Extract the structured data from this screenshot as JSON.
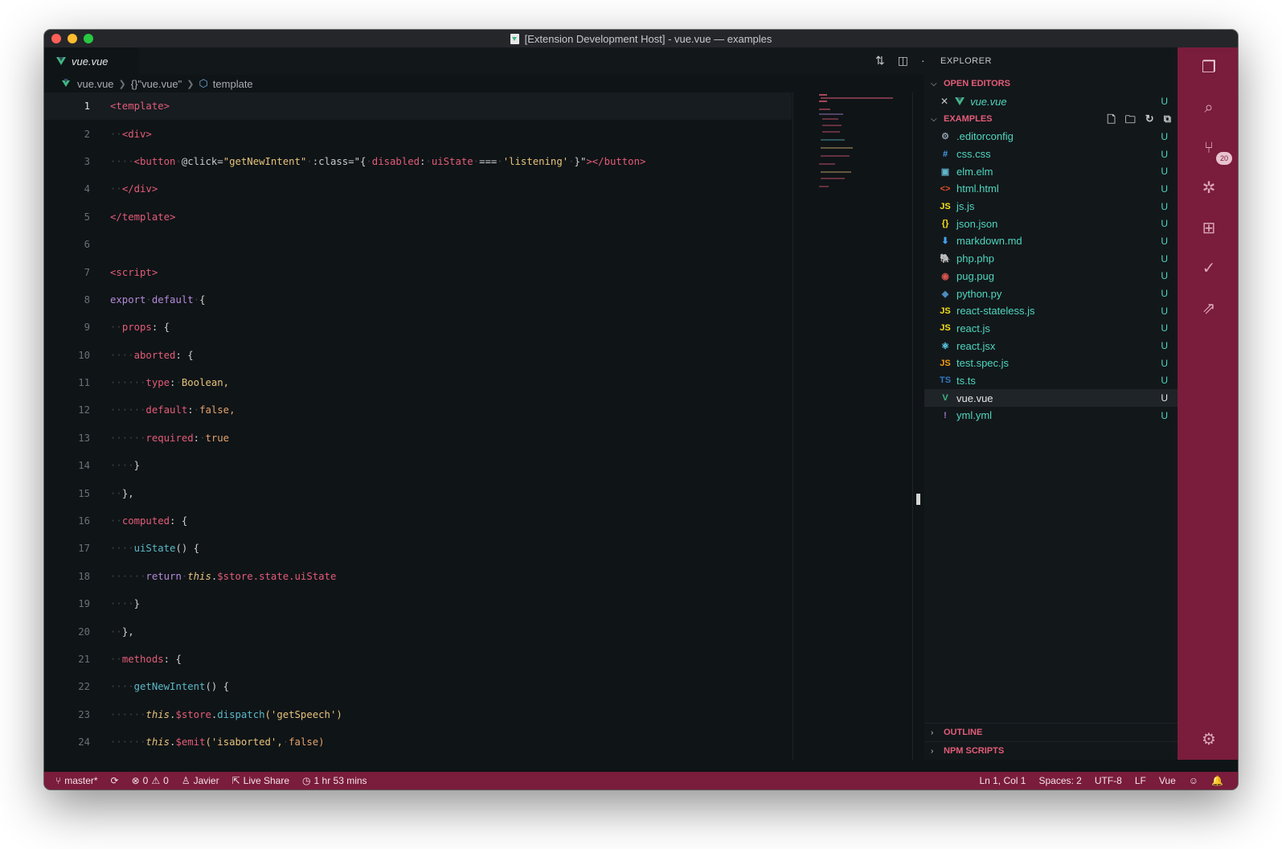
{
  "window": {
    "title": "[Extension Development Host] - vue.vue — examples"
  },
  "tab": {
    "label": "vue.vue"
  },
  "breadcrumb": {
    "file": "vue.vue",
    "object": "{}\"vue.vue\"",
    "node": "template"
  },
  "code_lines": [
    {
      "n": "1"
    },
    {
      "n": "2"
    },
    {
      "n": "3"
    },
    {
      "n": "4"
    },
    {
      "n": "5"
    },
    {
      "n": "6"
    },
    {
      "n": "7"
    },
    {
      "n": "8"
    },
    {
      "n": "9"
    },
    {
      "n": "10"
    },
    {
      "n": "11"
    },
    {
      "n": "12"
    },
    {
      "n": "13"
    },
    {
      "n": "14"
    },
    {
      "n": "15"
    },
    {
      "n": "16"
    },
    {
      "n": "17"
    },
    {
      "n": "18"
    },
    {
      "n": "19"
    },
    {
      "n": "20"
    },
    {
      "n": "21"
    },
    {
      "n": "22"
    },
    {
      "n": "23"
    },
    {
      "n": "24"
    }
  ],
  "code": {
    "l1": "<template>",
    "l2": "<div>",
    "l3_tag": "<button",
    "l3_click": "@click=",
    "l3_click_val": "\"getNewIntent\"",
    "l3_class": ":class=",
    "l3_class_open": "\"{",
    "l3_disabled": "disabled",
    "l3_colon": ":",
    "l3_uistate": "uiState",
    "l3_eq": "===",
    "l3_listening": "'listening'",
    "l3_close": "}\"",
    "l3_endtag": "></button>",
    "l4": "</div>",
    "l5": "</template>",
    "l7": "<script>",
    "l8_export": "export",
    "l8_default": "default",
    "l8_brace": "{",
    "l9_props": "props",
    "l9_rest": ": {",
    "l10_aborted": "aborted",
    "l10_rest": ": {",
    "l11_type": "type",
    "l11_val": "Boolean,",
    "l12_default": "default",
    "l12_val": "false,",
    "l13_required": "required",
    "l13_val": "true",
    "l14": "}",
    "l15": "},",
    "l16_computed": "computed",
    "l16_rest": ": {",
    "l17_fn": "uiState",
    "l17_rest": "() {",
    "l18_return": "return",
    "l18_this": "this",
    "l18_store": "$store",
    "l18_rest": ".state.uiState",
    "l19": "}",
    "l20": "},",
    "l21_methods": "methods",
    "l21_rest": ": {",
    "l22_fn": "getNewIntent",
    "l22_rest": "() {",
    "l23_this": "this",
    "l23_store": "$store",
    "l23_dispatch": "dispatch",
    "l23_arg": "('getSpeech')",
    "l24_this": "this",
    "l24_emit": "$emit",
    "l24_arg": "('isaborted',",
    "l24_false": "false)"
  },
  "sidebar": {
    "title": "EXPLORER",
    "open_editors": {
      "label": "OPEN EDITORS",
      "file": "vue.vue",
      "status": "U"
    },
    "examples": {
      "label": "EXAMPLES",
      "files": [
        {
          "name": ".editorconfig",
          "status": "U",
          "icon": "gear-icon",
          "glyph": "⚙",
          "color": "#8f9ba8"
        },
        {
          "name": "css.css",
          "status": "U",
          "icon": "hash-icon",
          "glyph": "#",
          "color": "#42a5f5"
        },
        {
          "name": "elm.elm",
          "status": "U",
          "icon": "elm-icon",
          "glyph": "▣",
          "color": "#60b5cc"
        },
        {
          "name": "html.html",
          "status": "U",
          "icon": "html-icon",
          "glyph": "<>",
          "color": "#e44d26"
        },
        {
          "name": "js.js",
          "status": "U",
          "icon": "js-icon",
          "glyph": "JS",
          "color": "#f5de19"
        },
        {
          "name": "json.json",
          "status": "U",
          "icon": "json-icon",
          "glyph": "{}",
          "color": "#f5de19"
        },
        {
          "name": "markdown.md",
          "status": "U",
          "icon": "markdown-icon",
          "glyph": "⬇",
          "color": "#42a5f5"
        },
        {
          "name": "php.php",
          "status": "U",
          "icon": "php-icon",
          "glyph": "🐘",
          "color": "#a074c4"
        },
        {
          "name": "pug.pug",
          "status": "U",
          "icon": "pug-icon",
          "glyph": "◉",
          "color": "#d9534f"
        },
        {
          "name": "python.py",
          "status": "U",
          "icon": "python-icon",
          "glyph": "◆",
          "color": "#4b8bbe"
        },
        {
          "name": "react-stateless.js",
          "status": "U",
          "icon": "js-icon",
          "glyph": "JS",
          "color": "#f5de19"
        },
        {
          "name": "react.js",
          "status": "U",
          "icon": "js-icon",
          "glyph": "JS",
          "color": "#f5de19"
        },
        {
          "name": "react.jsx",
          "status": "U",
          "icon": "react-icon",
          "glyph": "⚛",
          "color": "#61dafb"
        },
        {
          "name": "test.spec.js",
          "status": "U",
          "icon": "test-js-icon",
          "glyph": "JS",
          "color": "#f39c12"
        },
        {
          "name": "ts.ts",
          "status": "U",
          "icon": "ts-icon",
          "glyph": "TS",
          "color": "#3178c6"
        },
        {
          "name": "vue.vue",
          "status": "U",
          "icon": "vue-icon",
          "glyph": "V",
          "color": "#41b883"
        },
        {
          "name": "yml.yml",
          "status": "U",
          "icon": "yaml-icon",
          "glyph": "!",
          "color": "#a074c4"
        }
      ]
    },
    "outline": "OUTLINE",
    "npm_scripts": "NPM SCRIPTS"
  },
  "activity": {
    "scm_badge": "20"
  },
  "status": {
    "branch": "master*",
    "errors": "0",
    "warnings": "0",
    "user": "Javier",
    "live_share": "Live Share",
    "time": "1 hr 53 mins",
    "position": "Ln 1, Col 1",
    "spaces": "Spaces: 2",
    "encoding": "UTF-8",
    "eol": "LF",
    "language": "Vue"
  },
  "colors": {
    "accent": "#7a1c3b",
    "untracked": "#4fd6be",
    "tag": "#e35c78"
  }
}
